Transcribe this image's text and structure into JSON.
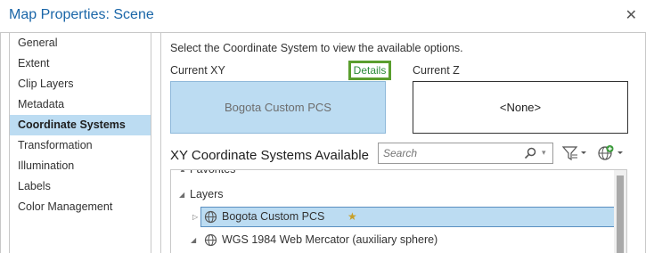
{
  "window": {
    "title": "Map Properties: Scene"
  },
  "sidebar": {
    "items": [
      {
        "label": "General",
        "active": false
      },
      {
        "label": "Extent",
        "active": false
      },
      {
        "label": "Clip Layers",
        "active": false
      },
      {
        "label": "Metadata",
        "active": false
      },
      {
        "label": "Coordinate Systems",
        "active": true
      },
      {
        "label": "Transformation",
        "active": false
      },
      {
        "label": "Illumination",
        "active": false
      },
      {
        "label": "Labels",
        "active": false
      },
      {
        "label": "Color Management",
        "active": false
      }
    ]
  },
  "main": {
    "instruction": "Select the Coordinate System to view the available options.",
    "current_xy_label": "Current XY",
    "details_link": "Details",
    "current_z_label": "Current Z",
    "current_xy_value": "Bogota Custom PCS",
    "current_z_value": "<None>",
    "section_title": "XY Coordinate Systems Available",
    "search_placeholder": "Search"
  },
  "tree": {
    "rows": [
      {
        "label": "Favorites"
      },
      {
        "label": "Layers"
      },
      {
        "label": "Bogota Custom PCS",
        "selected": true
      },
      {
        "label": "WGS 1984 Web Mercator (auxiliary sphere)"
      }
    ]
  },
  "colors": {
    "accent": "#1a66a8",
    "selection": "#bcdcf2",
    "details_border": "#5a9e2e"
  },
  "icons": [
    "close-icon",
    "search-icon",
    "filter-icon",
    "globe-add-icon",
    "globe-icon",
    "star-icon"
  ]
}
